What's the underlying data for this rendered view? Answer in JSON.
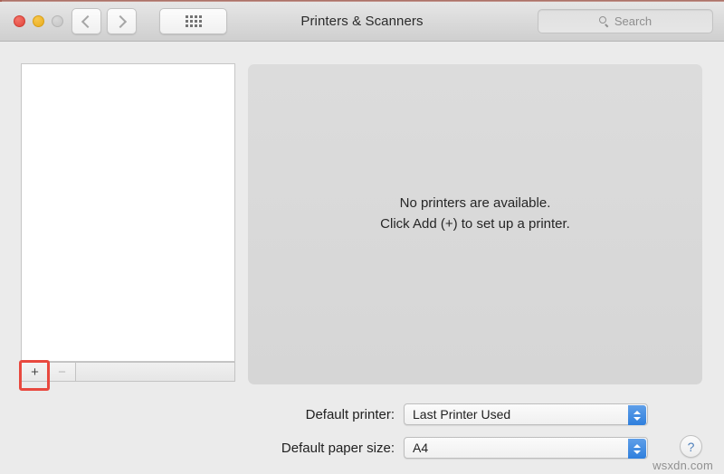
{
  "window": {
    "title": "Printers & Scanners",
    "traffic_lights": [
      {
        "name": "close",
        "color": "#e0443a",
        "enabled": true
      },
      {
        "name": "minimize",
        "color": "#e8ad1d",
        "enabled": true
      },
      {
        "name": "zoom",
        "color": "#c4c4c4",
        "enabled": false
      }
    ]
  },
  "toolbar": {
    "back_icon": "chevron-left-icon",
    "forward_icon": "chevron-right-icon",
    "show_all_icon": "grid-icon",
    "search": {
      "icon": "search-icon",
      "placeholder": "Search",
      "value": ""
    }
  },
  "printer_list": {
    "items": [],
    "add_label": "+",
    "remove_label": "−",
    "remove_enabled": false,
    "annotation": {
      "target": "add-printer-button",
      "color": "#e8493f"
    }
  },
  "main": {
    "empty_state": {
      "line1": "No printers are available.",
      "line2": "Click Add (+) to set up a printer."
    }
  },
  "preferences": {
    "default_printer": {
      "label": "Default printer:",
      "value": "Last Printer Used"
    },
    "default_paper_size": {
      "label": "Default paper size:",
      "value": "A4"
    }
  },
  "help": {
    "label": "?"
  },
  "watermark": {
    "text": "wsxdn.com"
  }
}
